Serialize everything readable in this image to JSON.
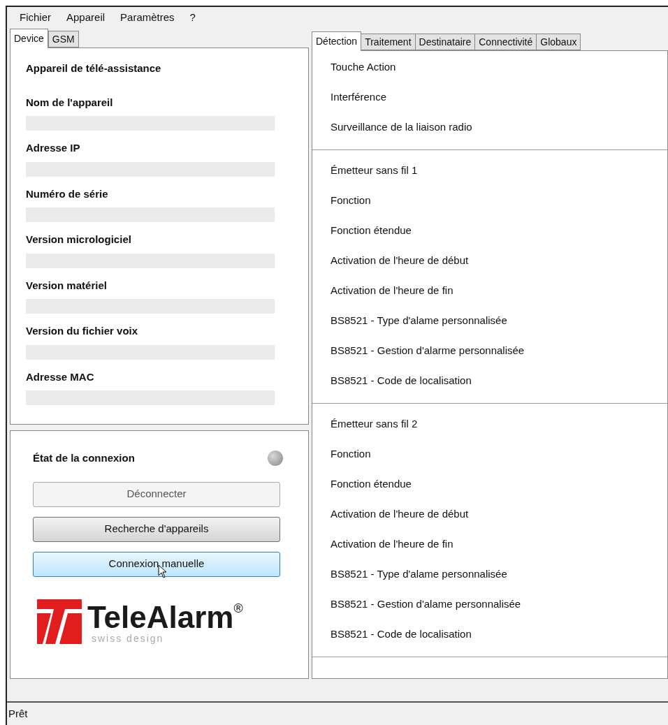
{
  "menu": [
    "Fichier",
    "Appareil",
    "Paramètres",
    "?"
  ],
  "left_tabs": [
    {
      "label": "Device",
      "selected": true
    },
    {
      "label": "GSM",
      "selected": false
    }
  ],
  "device": {
    "title": "Appareil de télé-assistance",
    "fields": [
      {
        "label": "Nom de l'appareil"
      },
      {
        "label": "Adresse IP"
      },
      {
        "label": "Numéro de série"
      },
      {
        "label": "Version micrologiciel"
      },
      {
        "label": "Version matériel"
      },
      {
        "label": "Version du fichier voix"
      },
      {
        "label": "Adresse MAC"
      }
    ]
  },
  "connection": {
    "label": "État de la connexion",
    "connected": false,
    "buttons": [
      {
        "label": "Déconnecter",
        "disabled": true,
        "hovered": false
      },
      {
        "label": "Recherche d'appareils",
        "disabled": false,
        "hovered": false
      },
      {
        "label": "Connexion manuelle",
        "disabled": false,
        "hovered": true
      }
    ]
  },
  "logo": {
    "name": "TeleAlarm",
    "mark": "®",
    "tagline": "swiss design"
  },
  "right_tabs": [
    {
      "label": "Détection",
      "selected": true
    },
    {
      "label": "Traitement",
      "selected": false
    },
    {
      "label": "Destinataire",
      "selected": false
    },
    {
      "label": "Connectivité",
      "selected": false
    },
    {
      "label": "Globaux",
      "selected": false
    }
  ],
  "sections": [
    {
      "items": [
        "Touche Action",
        "Interférence",
        "Surveillance de la liaison radio"
      ]
    },
    {
      "items": [
        "Émetteur sans fil 1",
        "Fonction",
        "Fonction étendue",
        "Activation de l'heure de début",
        "Activation de l'heure de fin",
        "BS8521 - Type d'alame personnalisée",
        "BS8521 - Gestion d'alarme personnalisée",
        "BS8521 - Code de localisation"
      ]
    },
    {
      "items": [
        "Émetteur sans fil 2",
        "Fonction",
        "Fonction étendue",
        "Activation de l'heure de début",
        "Activation de l'heure de fin",
        "BS8521 - Type d'alame personnalisée",
        "BS8521 - Gestion d'alame personnalisée",
        "BS8521 - Code de localisation"
      ]
    }
  ],
  "status_bar": "Prêt"
}
